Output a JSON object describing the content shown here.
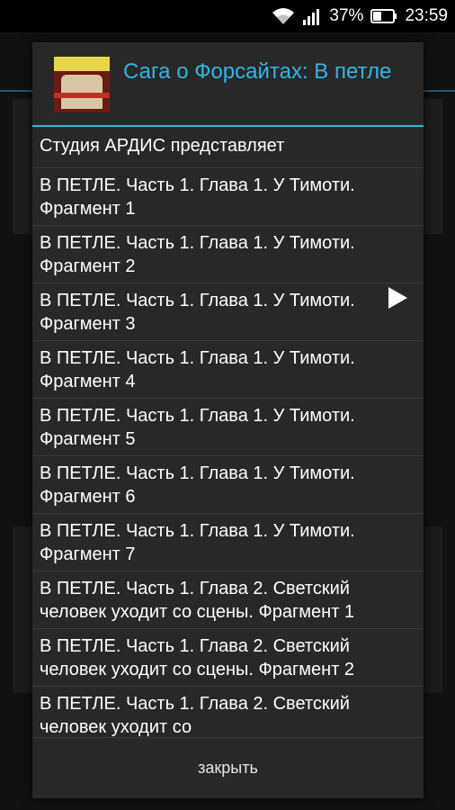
{
  "status_bar": {
    "battery_percent": "37%",
    "time": "23:59",
    "icons": [
      "wifi-icon",
      "signal-icon",
      "battery-icon"
    ]
  },
  "dialog": {
    "title": "Сага о Форсайтах: В петле",
    "items": [
      "Студия АРДИС представляет",
      "В ПЕТЛЕ. Часть 1. Глава 1. У Тимоти. Фрагмент 1",
      "В ПЕТЛЕ. Часть 1. Глава 1. У Тимоти. Фрагмент 2",
      "В ПЕТЛЕ. Часть 1. Глава 1. У Тимоти. Фрагмент 3",
      "В ПЕТЛЕ. Часть 1. Глава 1. У Тимоти. Фрагмент 4",
      "В ПЕТЛЕ. Часть 1. Глава 1. У Тимоти. Фрагмент 5",
      "В ПЕТЛЕ. Часть 1. Глава 1. У Тимоти. Фрагмент 6",
      "В ПЕТЛЕ. Часть 1. Глава 1. У Тимоти. Фрагмент 7",
      "В ПЕТЛЕ. Часть 1. Глава 2. Светский человек уходит со сцены. Фрагмент 1",
      "В ПЕТЛЕ. Часть 1. Глава 2. Светский человек уходит со сцены. Фрагмент 2",
      "В ПЕТЛЕ. Часть 1. Глава 2. Светский человек уходит со"
    ],
    "close_label": "закрыть",
    "playing_index": 3
  },
  "colors": {
    "accent": "#33b5e5",
    "dialog_bg": "#282828"
  }
}
